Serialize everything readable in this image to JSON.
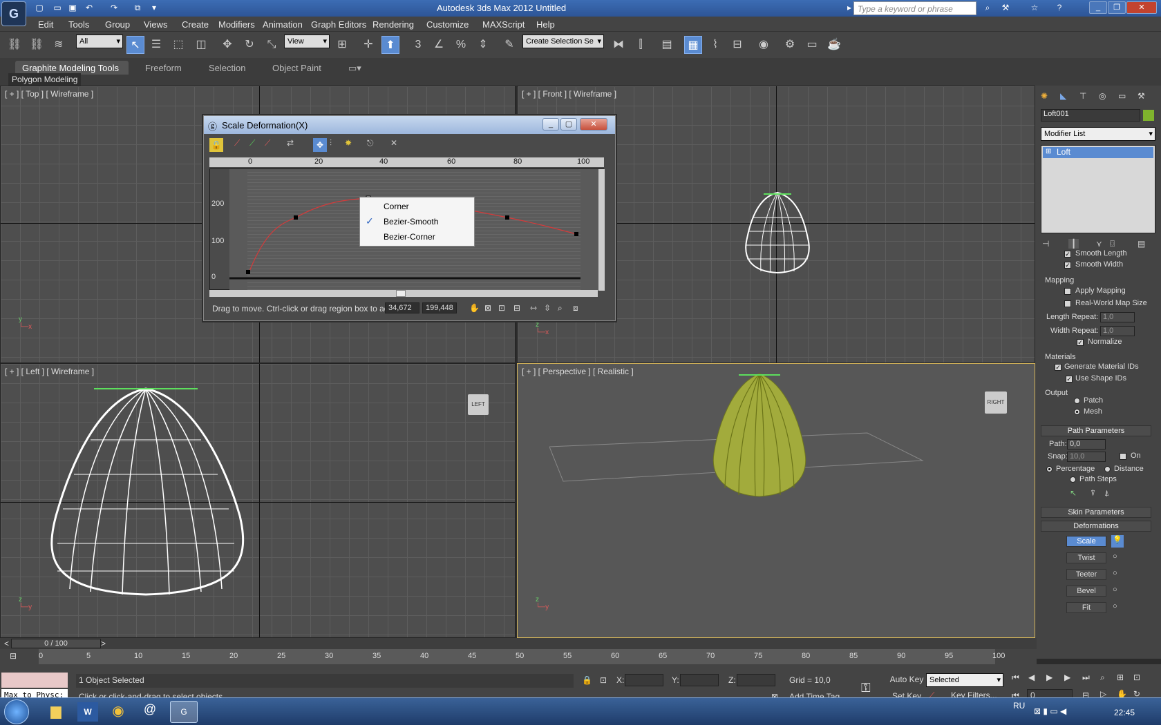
{
  "titlebar": {
    "title": "Autodesk 3ds Max  2012      Untitled",
    "search_placeholder": "Type a keyword or phrase"
  },
  "menubar": [
    "Edit",
    "Tools",
    "Group",
    "Views",
    "Create",
    "Modifiers",
    "Animation",
    "Graph Editors",
    "Rendering",
    "Customize",
    "MAXScript",
    "Help"
  ],
  "toolbar": {
    "filter_value": "All",
    "ref_coord_value": "View",
    "named_selection_placeholder": "Create Selection Se",
    "snap_labels": [
      "3",
      "%"
    ]
  },
  "ribbon": {
    "tabs": [
      "Graphite Modeling Tools",
      "Freeform",
      "Selection",
      "Object Paint"
    ],
    "panel": "Polygon Modeling"
  },
  "viewports": {
    "top": "[ + ] [ Top ] [ Wireframe ]",
    "front": "[ + ] [ Front ] [ Wireframe ]",
    "left": "[ + ] [ Left ] [ Wireframe ]",
    "perspective": "[ + ] [ Perspective ] [ Realistic ]",
    "viewcube_left": "LEFT",
    "viewcube_right": "RIGHT"
  },
  "dialog": {
    "title": "Scale Deformation(X)",
    "ruler_ticks": [
      "0",
      "20",
      "40",
      "60",
      "80",
      "100"
    ],
    "y_ticks": [
      "200",
      "100",
      "0"
    ],
    "status": "Drag to move. Ctrl-click or drag region box to add to",
    "coord_x": "34,672",
    "coord_y": "199,448",
    "context_menu": [
      {
        "label": "Corner",
        "checked": false
      },
      {
        "label": "Bezier-Smooth",
        "checked": true
      },
      {
        "label": "Bezier-Corner",
        "checked": false
      }
    ]
  },
  "command_panel": {
    "object_name": "Loft001",
    "modifier_list": "Modifier List",
    "stack_item": "Loft",
    "smooth_length": "Smooth Length",
    "smooth_width": "Smooth Width",
    "mapping_title": "Mapping",
    "apply_mapping": "Apply Mapping",
    "real_world": "Real-World Map Size",
    "length_repeat_lbl": "Length Repeat:",
    "length_repeat_val": "1,0",
    "width_repeat_lbl": "Width Repeat:",
    "width_repeat_val": "1,0",
    "normalize": "Normalize",
    "materials_title": "Materials",
    "gen_mat_ids": "Generate Material IDs",
    "use_shape_ids": "Use Shape IDs",
    "output_title": "Output",
    "patch": "Patch",
    "mesh": "Mesh",
    "path_params": "Path Parameters",
    "path_lbl": "Path:",
    "path_val": "0,0",
    "snap_lbl": "Snap:",
    "snap_val": "10,0",
    "on_lbl": "On",
    "percentage": "Percentage",
    "distance": "Distance",
    "path_steps": "Path Steps",
    "skin_params": "Skin Parameters",
    "deformations": "Deformations",
    "def_buttons": [
      "Scale",
      "Twist",
      "Teeter",
      "Bevel",
      "Fit"
    ]
  },
  "timeline": {
    "frame": "0 / 100",
    "ticks": [
      "0",
      "5",
      "10",
      "15",
      "20",
      "25",
      "30",
      "35",
      "40",
      "45",
      "50",
      "55",
      "60",
      "65",
      "70",
      "75",
      "80",
      "85",
      "90",
      "95",
      "100"
    ]
  },
  "statusbar": {
    "script_label": "Max to Physc:",
    "selected": "1 Object Selected",
    "prompt": "Click or click-and-drag to select objects",
    "x_lbl": "X:",
    "y_lbl": "Y:",
    "z_lbl": "Z:",
    "grid": "Grid = 10,0",
    "auto_key": "Auto Key",
    "set_key": "Set Key",
    "selected_dd": "Selected",
    "key_filters": "Key Filters...",
    "add_time_tag": "Add Time Tag",
    "frame_field": "0"
  },
  "taskbar": {
    "lang": "RU",
    "time": "22:45"
  }
}
